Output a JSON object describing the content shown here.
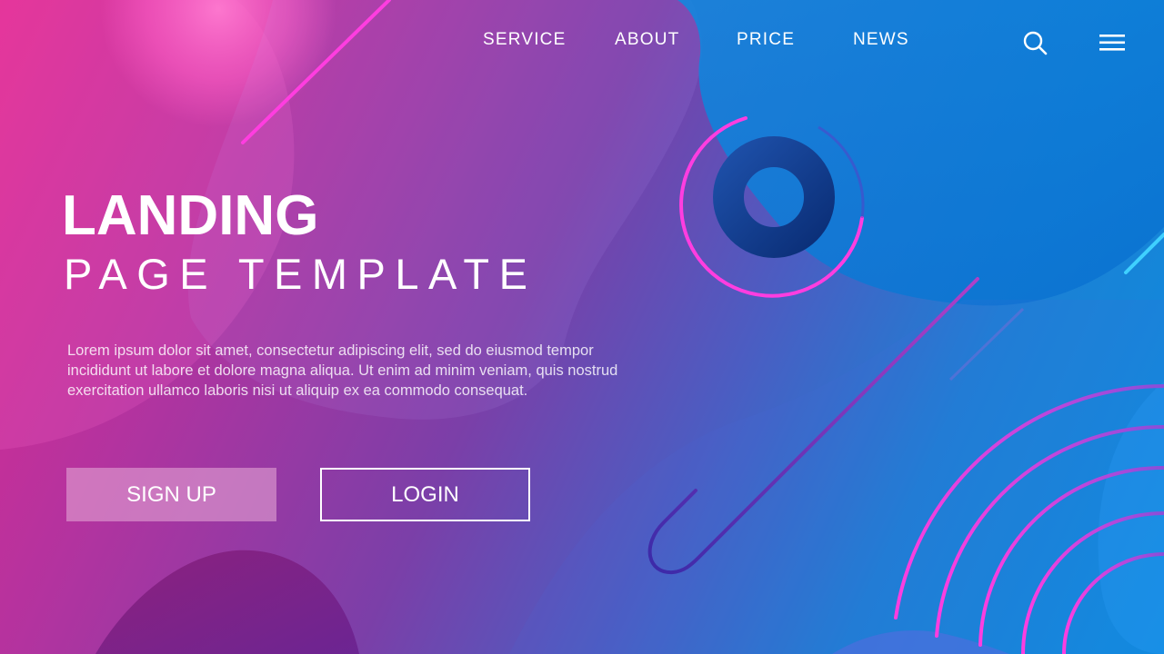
{
  "nav": {
    "items": [
      {
        "label": "SERVICE"
      },
      {
        "label": "ABOUT"
      },
      {
        "label": "PRICE"
      },
      {
        "label": "NEWS"
      }
    ],
    "icons": [
      "search-icon",
      "menu-icon"
    ]
  },
  "hero": {
    "title": "LANDING",
    "subtitle": "PAGE TEMPLATE",
    "body_lines": [
      "Lorem ipsum dolor sit amet, consectetur adipiscing elit, sed do eiusmod tempor",
      "incididunt ut labore et dolore magna aliqua. Ut enim ad minim veniam, quis nostrud",
      "exercitation ullamco laboris nisi ut aliquip ex ea commodo consequat."
    ]
  },
  "buttons": {
    "signup_label": "SIGN UP",
    "login_label": "LOGIN"
  },
  "colors": {
    "pink": "#e02a8f",
    "purple": "#7b3fa8",
    "blue": "#0a8fe0",
    "accent_line": "#ff3de0",
    "signup_fill": "#e0a0d2"
  }
}
